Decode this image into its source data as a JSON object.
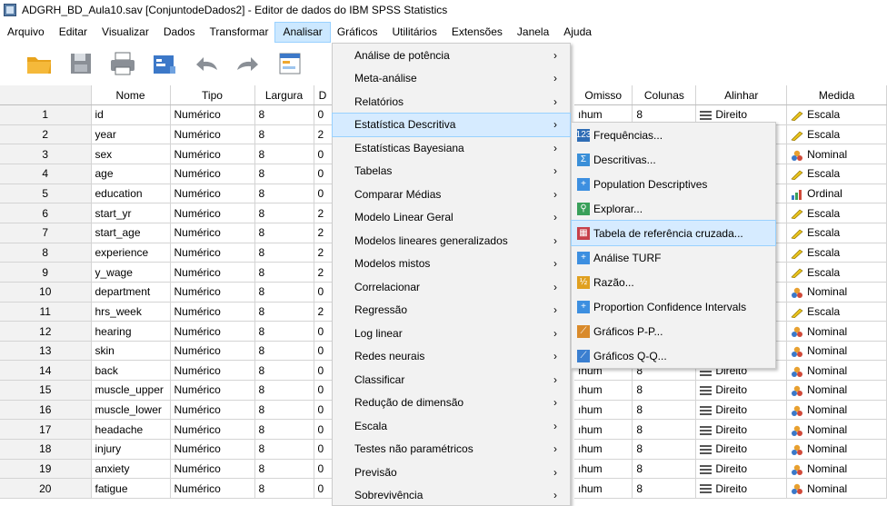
{
  "window": {
    "title": "ADGRH_BD_Aula10.sav [ConjuntodeDados2] - Editor de dados do IBM SPSS Statistics"
  },
  "menubar": [
    "Arquivo",
    "Editar",
    "Visualizar",
    "Dados",
    "Transformar",
    "Analisar",
    "Gráficos",
    "Utilitários",
    "Extensões",
    "Janela",
    "Ajuda"
  ],
  "toolbar": {
    "icons": [
      "open-folder-icon",
      "save-icon",
      "print-icon",
      "dialog-recall-icon",
      "undo-icon",
      "redo-icon",
      "goto-case-icon",
      "variables-icon",
      "split-file-icon",
      "weight-icon",
      "value-labels-icon",
      "find-icon"
    ]
  },
  "grid": {
    "headers": {
      "name": "Nome",
      "type": "Tipo",
      "width": "Largura",
      "decimals": "D"
    },
    "rows": [
      {
        "n": "1",
        "name": "id",
        "type": "Numérico",
        "width": "8",
        "dec": "0"
      },
      {
        "n": "2",
        "name": "year",
        "type": "Numérico",
        "width": "8",
        "dec": "2"
      },
      {
        "n": "3",
        "name": "sex",
        "type": "Numérico",
        "width": "8",
        "dec": "0"
      },
      {
        "n": "4",
        "name": "age",
        "type": "Numérico",
        "width": "8",
        "dec": "0"
      },
      {
        "n": "5",
        "name": "education",
        "type": "Numérico",
        "width": "8",
        "dec": "0"
      },
      {
        "n": "6",
        "name": "start_yr",
        "type": "Numérico",
        "width": "8",
        "dec": "2"
      },
      {
        "n": "7",
        "name": "start_age",
        "type": "Numérico",
        "width": "8",
        "dec": "2"
      },
      {
        "n": "8",
        "name": "experience",
        "type": "Numérico",
        "width": "8",
        "dec": "2"
      },
      {
        "n": "9",
        "name": "y_wage",
        "type": "Numérico",
        "width": "8",
        "dec": "2"
      },
      {
        "n": "10",
        "name": "department",
        "type": "Numérico",
        "width": "8",
        "dec": "0"
      },
      {
        "n": "11",
        "name": "hrs_week",
        "type": "Numérico",
        "width": "8",
        "dec": "2"
      },
      {
        "n": "12",
        "name": "hearing",
        "type": "Numérico",
        "width": "8",
        "dec": "0"
      },
      {
        "n": "13",
        "name": "skin",
        "type": "Numérico",
        "width": "8",
        "dec": "0"
      },
      {
        "n": "14",
        "name": "back",
        "type": "Numérico",
        "width": "8",
        "dec": "0"
      },
      {
        "n": "15",
        "name": "muscle_upper",
        "type": "Numérico",
        "width": "8",
        "dec": "0"
      },
      {
        "n": "16",
        "name": "muscle_lower",
        "type": "Numérico",
        "width": "8",
        "dec": "0"
      },
      {
        "n": "17",
        "name": "headache",
        "type": "Numérico",
        "width": "8",
        "dec": "0"
      },
      {
        "n": "18",
        "name": "injury",
        "type": "Numérico",
        "width": "8",
        "dec": "0"
      },
      {
        "n": "19",
        "name": "anxiety",
        "type": "Numérico",
        "width": "8",
        "dec": "0"
      },
      {
        "n": "20",
        "name": "fatigue",
        "type": "Numérico",
        "width": "8",
        "dec": "0"
      }
    ]
  },
  "rgrid": {
    "headers": {
      "missing": "Omisso",
      "columns": "Colunas",
      "align": "Alinhar",
      "measure": "Medida"
    },
    "rows": [
      {
        "missing": "ıhum",
        "columns": "8",
        "align": "Direito",
        "measure": "Escala",
        "mtype": "scale"
      },
      {
        "missing": "",
        "columns": "",
        "align": "",
        "measure": "Escala",
        "mtype": "scale"
      },
      {
        "missing": "",
        "columns": "",
        "align": "",
        "measure": "Nominal",
        "mtype": "nominal"
      },
      {
        "missing": "",
        "columns": "",
        "align": "",
        "measure": "Escala",
        "mtype": "scale"
      },
      {
        "missing": "",
        "columns": "",
        "align": "",
        "measure": "Ordinal",
        "mtype": "ordinal"
      },
      {
        "missing": "",
        "columns": "",
        "align": "",
        "measure": "Escala",
        "mtype": "scale"
      },
      {
        "missing": "",
        "columns": "",
        "align": "",
        "measure": "Escala",
        "mtype": "scale"
      },
      {
        "missing": "",
        "columns": "",
        "align": "",
        "measure": "Escala",
        "mtype": "scale"
      },
      {
        "missing": "",
        "columns": "",
        "align": "",
        "measure": "Escala",
        "mtype": "scale"
      },
      {
        "missing": "",
        "columns": "",
        "align": "",
        "measure": "Nominal",
        "mtype": "nominal"
      },
      {
        "missing": "",
        "columns": "",
        "align": "",
        "measure": "Escala",
        "mtype": "scale"
      },
      {
        "missing": "",
        "columns": "",
        "align": "",
        "measure": "Nominal",
        "mtype": "nominal"
      },
      {
        "missing": "",
        "columns": "",
        "align": "",
        "measure": "Nominal",
        "mtype": "nominal"
      },
      {
        "missing": "ıhum",
        "columns": "8",
        "align": "Direito",
        "measure": "Nominal",
        "mtype": "nominal"
      },
      {
        "missing": "ıhum",
        "columns": "8",
        "align": "Direito",
        "measure": "Nominal",
        "mtype": "nominal"
      },
      {
        "missing": "ıhum",
        "columns": "8",
        "align": "Direito",
        "measure": "Nominal",
        "mtype": "nominal"
      },
      {
        "missing": "ıhum",
        "columns": "8",
        "align": "Direito",
        "measure": "Nominal",
        "mtype": "nominal"
      },
      {
        "missing": "ıhum",
        "columns": "8",
        "align": "Direito",
        "measure": "Nominal",
        "mtype": "nominal"
      },
      {
        "missing": "ıhum",
        "columns": "8",
        "align": "Direito",
        "measure": "Nominal",
        "mtype": "nominal"
      },
      {
        "missing": "ıhum",
        "columns": "8",
        "align": "Direito",
        "measure": "Nominal",
        "mtype": "nominal"
      }
    ]
  },
  "analyze_menu": [
    {
      "label": "Análise de potência",
      "highlighted": false
    },
    {
      "label": "Meta-análise",
      "highlighted": false
    },
    {
      "label": "Relatórios",
      "highlighted": false
    },
    {
      "label": "Estatística Descritiva",
      "highlighted": true
    },
    {
      "label": "Estatísticas Bayesiana",
      "highlighted": false
    },
    {
      "label": "Tabelas",
      "highlighted": false
    },
    {
      "label": "Comparar Médias",
      "highlighted": false
    },
    {
      "label": "Modelo Linear Geral",
      "highlighted": false
    },
    {
      "label": "Modelos lineares generalizados",
      "highlighted": false
    },
    {
      "label": "Modelos mistos",
      "highlighted": false
    },
    {
      "label": "Correlacionar",
      "highlighted": false
    },
    {
      "label": "Regressão",
      "highlighted": false
    },
    {
      "label": "Log linear",
      "highlighted": false
    },
    {
      "label": "Redes neurais",
      "highlighted": false
    },
    {
      "label": "Classificar",
      "highlighted": false
    },
    {
      "label": "Redução de dimensão",
      "highlighted": false
    },
    {
      "label": "Escala",
      "highlighted": false
    },
    {
      "label": "Testes não paramétricos",
      "highlighted": false
    },
    {
      "label": "Previsão",
      "highlighted": false
    },
    {
      "label": "Sobrevivência",
      "highlighted": false
    }
  ],
  "descriptive_submenu": [
    {
      "label": "Frequências...",
      "icon": "frequencies-icon",
      "color": "#2f6db5",
      "glyph": "123",
      "highlighted": false
    },
    {
      "label": "Descritivas...",
      "icon": "descriptives-icon",
      "color": "#3a8fd8",
      "glyph": "Σ",
      "highlighted": false
    },
    {
      "label": "Population Descriptives",
      "icon": "population-descriptives-icon",
      "color": "#3d8fe0",
      "glyph": "+",
      "highlighted": false
    },
    {
      "label": "Explorar...",
      "icon": "explore-icon",
      "color": "#3aa05a",
      "glyph": "⚲",
      "highlighted": false
    },
    {
      "label": "Tabela de referência cruzada...",
      "icon": "crosstabs-icon",
      "color": "#c7404a",
      "glyph": "▦",
      "highlighted": true
    },
    {
      "label": "Análise TURF",
      "icon": "turf-icon",
      "color": "#3d8fe0",
      "glyph": "+",
      "highlighted": false
    },
    {
      "label": "Razão...",
      "icon": "ratio-icon",
      "color": "#e0a020",
      "glyph": "½",
      "highlighted": false
    },
    {
      "label": "Proportion Confidence Intervals",
      "icon": "proportion-ci-icon",
      "color": "#3d8fe0",
      "glyph": "+",
      "highlighted": false
    },
    {
      "label": "Gráficos P-P...",
      "icon": "pp-plot-icon",
      "color": "#d98a2b",
      "glyph": "⟋",
      "highlighted": false
    },
    {
      "label": "Gráficos Q-Q...",
      "icon": "qq-plot-icon",
      "color": "#3b7fd0",
      "glyph": "⟋",
      "highlighted": false
    }
  ]
}
